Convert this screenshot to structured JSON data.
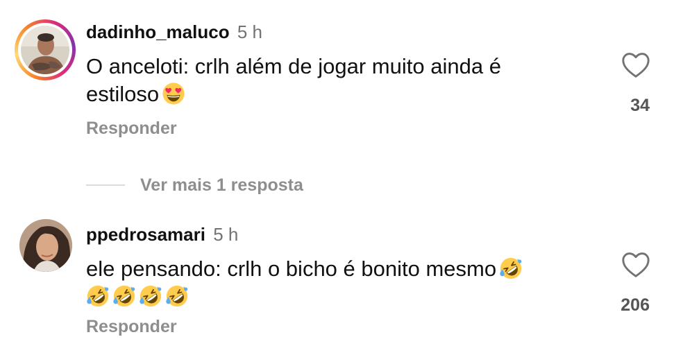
{
  "comments": [
    {
      "username": "dadinho_maluco",
      "time": "5 h",
      "text": "O anceloti: crlh além de jogar muito ainda é estiloso",
      "emojis": [
        "heart-eyes-emoji"
      ],
      "likes": "34",
      "reply_label": "Responder",
      "has_story_ring": true,
      "view_replies_label": "Ver mais 1 resposta"
    },
    {
      "username": "ppedrosamari",
      "time": "5 h",
      "text": "ele pensando: crlh o bicho é bonito mesmo",
      "emojis": [
        "rofl-emoji",
        "rofl-emoji",
        "rofl-emoji",
        "rofl-emoji",
        "rofl-emoji"
      ],
      "likes": "206",
      "reply_label": "Responder",
      "has_story_ring": false
    }
  ],
  "icons": {
    "like": "heart-outline-icon"
  },
  "colors": {
    "text": "#111111",
    "muted": "#737373",
    "action": "#8e8e8e",
    "story_ring_start": "#f58529",
    "story_ring_end": "#dd2a7b"
  }
}
